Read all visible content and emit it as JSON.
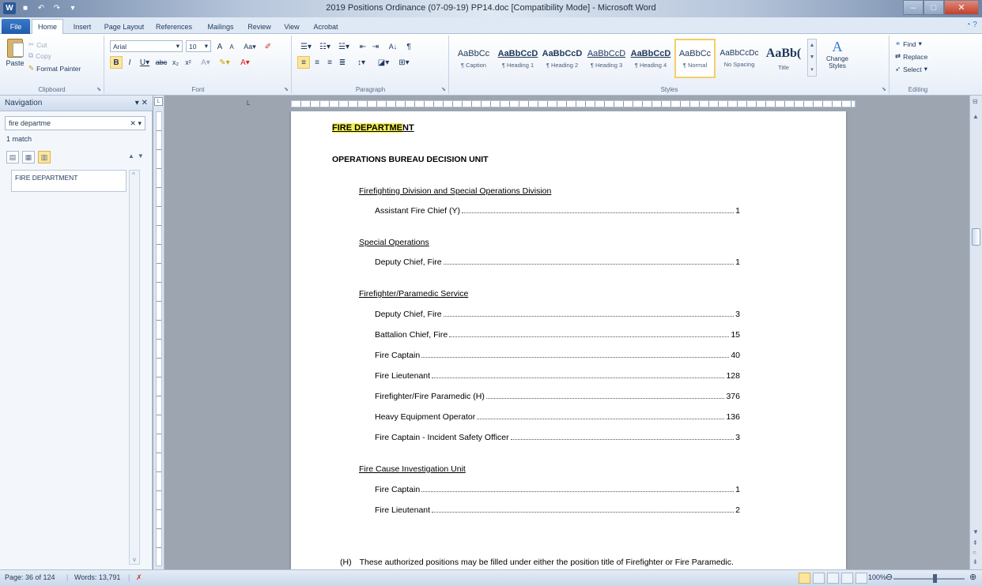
{
  "window": {
    "title": "2019 Positions Ordinance (07-09-19) PP14.doc [Compatibility Mode] - Microsoft Word",
    "word_icon_label": "W"
  },
  "tabs": [
    "File",
    "Home",
    "Insert",
    "Page Layout",
    "References",
    "Mailings",
    "Review",
    "View",
    "Acrobat"
  ],
  "clipboard": {
    "paste": "Paste",
    "cut": "Cut",
    "copy": "Copy",
    "format_painter": "Format Painter",
    "label": "Clipboard"
  },
  "font": {
    "name": "Arial",
    "size": "10",
    "label": "Font"
  },
  "paragraph": {
    "label": "Paragraph"
  },
  "styles": {
    "label": "Styles",
    "items": [
      {
        "preview": "AaBbCc",
        "name": "¶ Caption"
      },
      {
        "preview": "AaBbCcD",
        "name": "¶ Heading 1"
      },
      {
        "preview": "AaBbCcD",
        "name": "¶ Heading 2"
      },
      {
        "preview": "AaBbCcD",
        "name": "¶ Heading 3"
      },
      {
        "preview": "AaBbCcD",
        "name": "¶ Heading 4"
      },
      {
        "preview": "AaBbCc",
        "name": "¶ Normal"
      },
      {
        "preview": "AaBbCcDc",
        "name": "No Spacing"
      },
      {
        "preview": "AaBb(",
        "name": "Title"
      }
    ],
    "change_styles": "Change Styles"
  },
  "editing": {
    "label": "Editing",
    "find": "Find",
    "replace": "Replace",
    "select": "Select"
  },
  "navigation": {
    "title": "Navigation",
    "search_value": "fire departme",
    "match_count": "1 match",
    "result": "FIRE DEPARTMENT"
  },
  "document": {
    "heading_highlight": "FIRE DEPARTME",
    "heading_rest": "NT",
    "unit_title": "OPERATIONS BUREAU DECISION UNIT",
    "sections": [
      {
        "title": "Firefighting Division and Special Operations Division",
        "entries": [
          {
            "name": "Assistant Fire Chief (Y)",
            "count": "1"
          }
        ]
      },
      {
        "title": "Special Operations",
        "entries": [
          {
            "name": "Deputy Chief, Fire",
            "count": "1"
          }
        ]
      },
      {
        "title": "Firefighter/Paramedic Service",
        "entries": [
          {
            "name": "Deputy Chief, Fire",
            "count": "3"
          },
          {
            "name": "Battalion Chief, Fire",
            "count": "15"
          },
          {
            "name": "Fire Captain",
            "count": "40"
          },
          {
            "name": "Fire Lieutenant",
            "count": "128"
          },
          {
            "name": "Firefighter/Fire Paramedic (H)",
            "count": "376"
          },
          {
            "name": "Heavy Equipment Operator",
            "count": "136"
          },
          {
            "name": "Fire Captain - Incident Safety Officer",
            "count": "3"
          }
        ]
      },
      {
        "title": "Fire Cause Investigation Unit",
        "entries": [
          {
            "name": "Fire Captain",
            "count": "1"
          },
          {
            "name": "Fire Lieutenant",
            "count": "2"
          }
        ]
      }
    ],
    "footnote_mark": "(H)",
    "footnote_text": "These authorized positions may be filled under either the position title of Firefighter or Fire Paramedic."
  },
  "status": {
    "page": "Page: 36 of 124",
    "words": "Words: 13,791",
    "zoom": "100%"
  }
}
